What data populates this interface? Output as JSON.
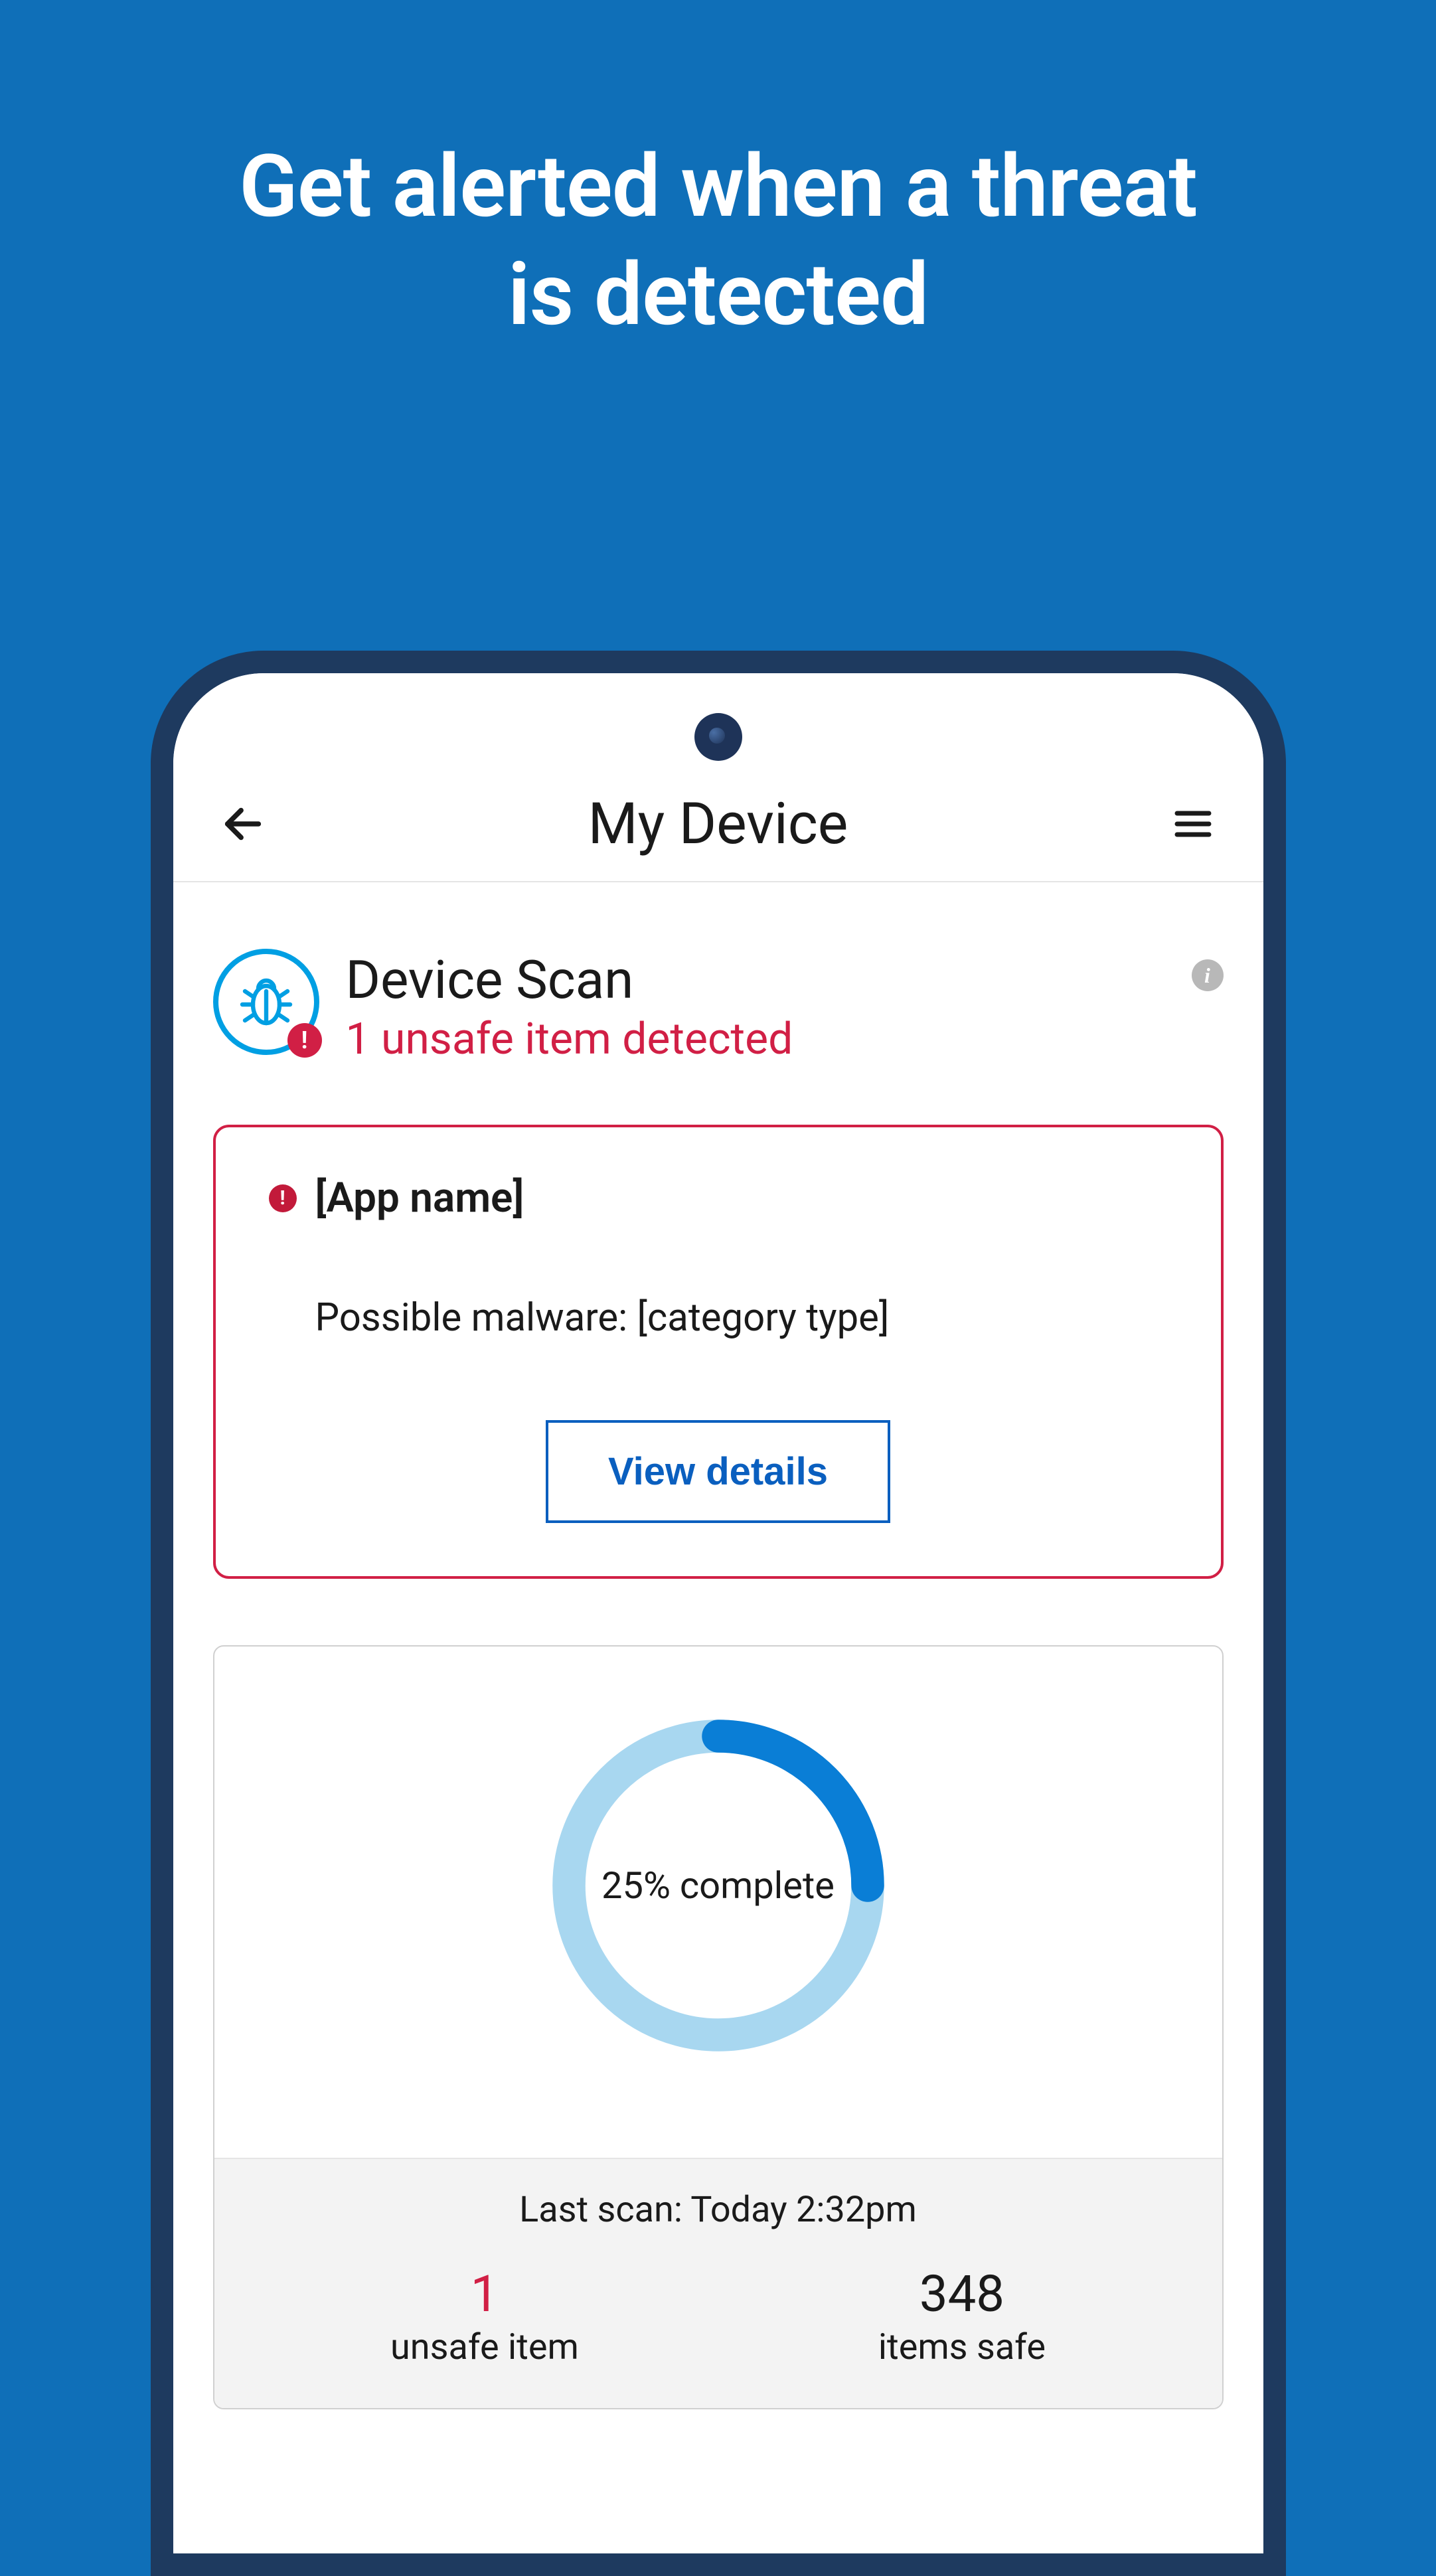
{
  "promo": {
    "headline_l1": "Get alerted when a threat",
    "headline_l2": "is detected"
  },
  "app": {
    "header_title": "My Device"
  },
  "scan": {
    "title": "Device Scan",
    "subtitle": "1 unsafe item detected"
  },
  "alert": {
    "app_name": "[App name]",
    "description": "Possible malware: [category type]",
    "action_label": "View details"
  },
  "progress": {
    "percent": 25,
    "label": "25% complete",
    "last_scan": "Last scan: Today 2:32pm",
    "unsafe_count": "1",
    "unsafe_label": "unsafe item",
    "safe_count": "348",
    "safe_label": "items safe"
  },
  "colors": {
    "accent_blue": "#0a5fbf",
    "ring_fg": "#0a7ed6",
    "ring_bg": "#a8d7f0",
    "danger": "#d11f45"
  }
}
